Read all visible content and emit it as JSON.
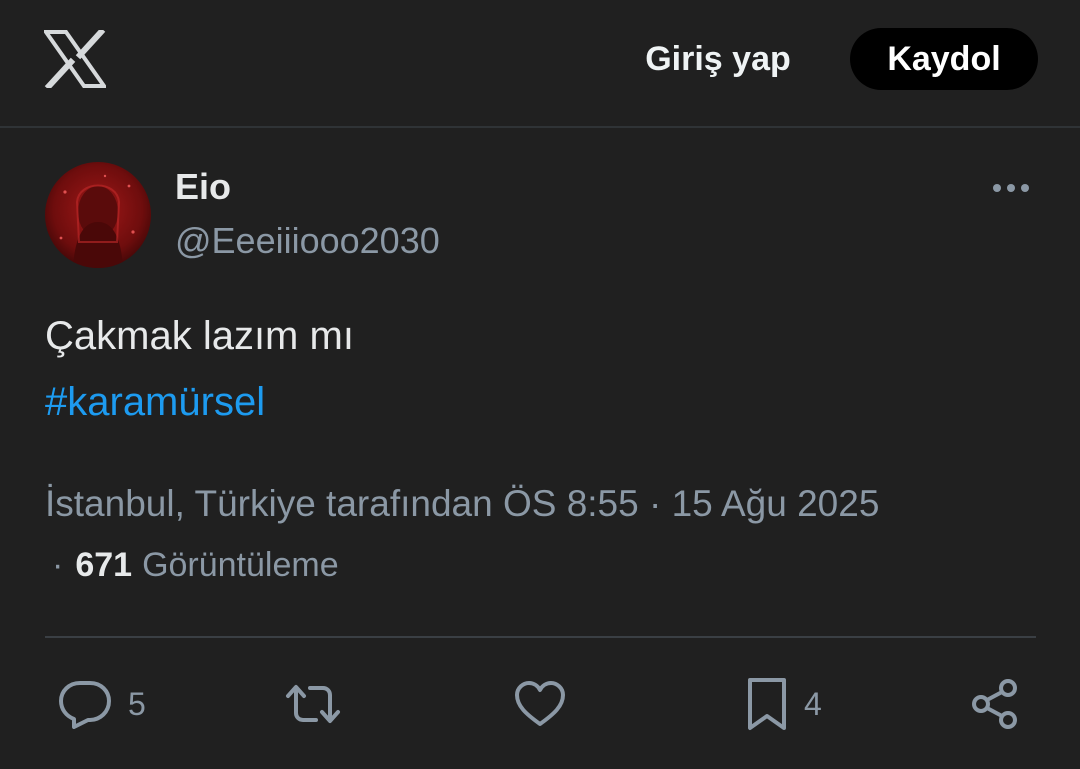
{
  "header": {
    "logo_icon": "x-logo-icon",
    "login_label": "Giriş yap",
    "signup_label": "Kaydol"
  },
  "author": {
    "display_name": "Eio",
    "handle": "@Eeeiiiooo2030",
    "avatar_color": "#8b1a1a"
  },
  "tweet": {
    "text": "Çakmak lazım mı",
    "hashtag": "#karamürsel",
    "location_time": "İstanbul, Türkiye tarafından ÖS 8:55 · 15 Ağu 2025",
    "views_separator": "·",
    "views_count": "671",
    "views_label": "Görüntüleme"
  },
  "actions": {
    "reply": {
      "icon": "reply-icon",
      "count": "5"
    },
    "retweet": {
      "icon": "retweet-icon",
      "count": ""
    },
    "like": {
      "icon": "heart-icon",
      "count": ""
    },
    "bookmark": {
      "icon": "bookmark-icon",
      "count": "4"
    },
    "share": {
      "icon": "share-icon"
    }
  },
  "colors": {
    "background": "#202020",
    "accent": "#1d9bf0",
    "muted": "#8b98a5",
    "text": "#e7e9ea"
  }
}
